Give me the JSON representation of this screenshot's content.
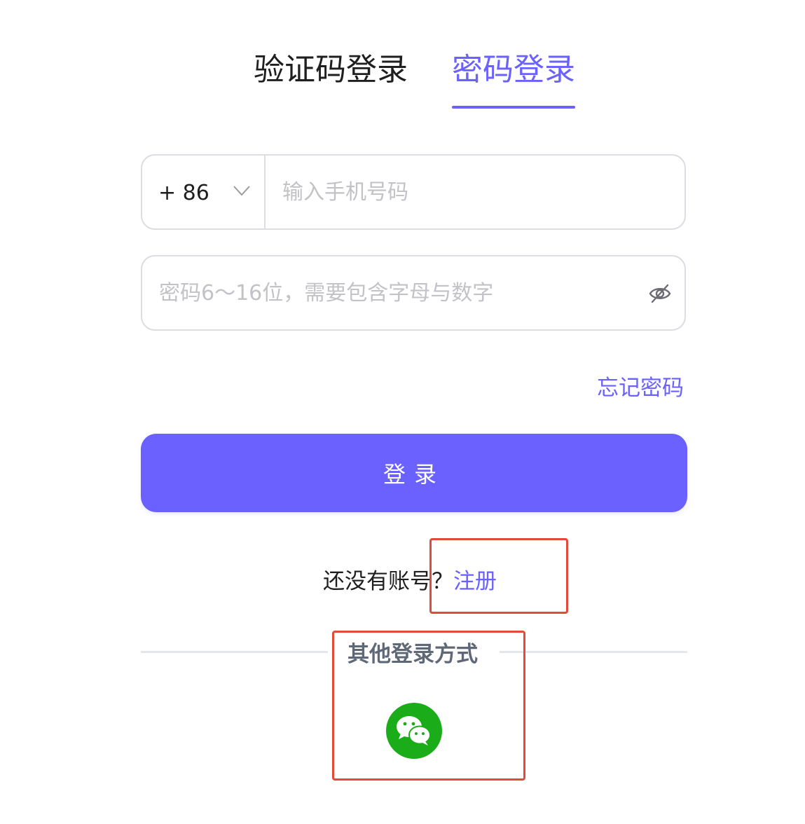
{
  "tabs": {
    "sms_login": "验证码登录",
    "password_login": "密码登录",
    "active": "password_login"
  },
  "phone_field": {
    "country_code": "+ 86",
    "placeholder": "输入手机号码",
    "value": ""
  },
  "password_field": {
    "placeholder": "密码6～16位，需要包含字母与数字",
    "value": "",
    "visibility_icon": "eye-off-icon"
  },
  "forgot_password": "忘记密码",
  "login_button": "登录",
  "register": {
    "prompt": "还没有账号？",
    "link": "注册"
  },
  "other_login": {
    "title": "其他登录方式",
    "methods": [
      {
        "icon": "wechat-icon",
        "color": "#1aad19"
      }
    ]
  },
  "colors": {
    "accent": "#6a61ff",
    "highlight_box": "#e34a3a",
    "wechat": "#1aad19"
  }
}
